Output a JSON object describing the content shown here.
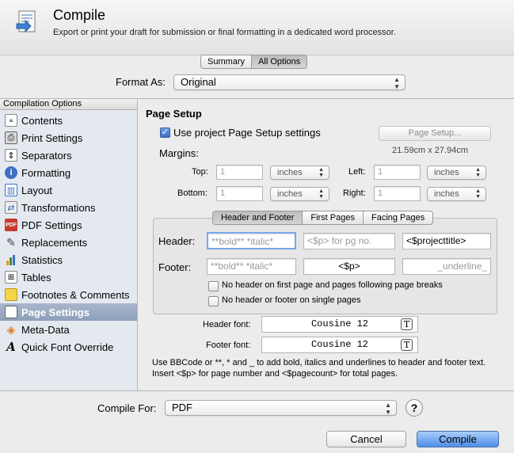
{
  "header": {
    "title": "Compile",
    "subtitle": "Export or print your draft for submission or final formatting in a dedicated word processor."
  },
  "view_tabs": [
    "Summary",
    "All Options"
  ],
  "format_as": {
    "label": "Format As:",
    "value": "Original"
  },
  "sidebar": {
    "header": "Compilation Options",
    "items": [
      {
        "label": "Contents",
        "icon": "contents-icon"
      },
      {
        "label": "Print Settings",
        "icon": "printer-icon"
      },
      {
        "label": "Separators",
        "icon": "separators-icon"
      },
      {
        "label": "Formatting",
        "icon": "formatting-icon"
      },
      {
        "label": "Layout",
        "icon": "layout-icon"
      },
      {
        "label": "Transformations",
        "icon": "transformations-icon"
      },
      {
        "label": "PDF Settings",
        "icon": "pdf-icon"
      },
      {
        "label": "Replacements",
        "icon": "replacements-icon"
      },
      {
        "label": "Statistics",
        "icon": "statistics-icon"
      },
      {
        "label": "Tables",
        "icon": "tables-icon"
      },
      {
        "label": "Footnotes & Comments",
        "icon": "footnotes-icon"
      },
      {
        "label": "Page Settings",
        "icon": "page-settings-icon"
      },
      {
        "label": "Meta-Data",
        "icon": "tag-icon"
      },
      {
        "label": "Quick Font Override",
        "icon": "font-icon"
      }
    ],
    "selected": "Page Settings"
  },
  "page_setup": {
    "heading": "Page Setup",
    "use_project_label": "Use project Page Setup settings",
    "use_project_checked": true,
    "page_setup_button": "Page Setup...",
    "paper_size": "21.59cm x 27.94cm",
    "margins_label": "Margins:",
    "margins": {
      "top": {
        "label": "Top:",
        "value": "1",
        "unit": "inches"
      },
      "left": {
        "label": "Left:",
        "value": "1",
        "unit": "inches"
      },
      "bottom": {
        "label": "Bottom:",
        "value": "1",
        "unit": "inches"
      },
      "right": {
        "label": "Right:",
        "value": "1",
        "unit": "inches"
      }
    }
  },
  "hf_tabs": [
    "Header and Footer",
    "First Pages",
    "Facing Pages"
  ],
  "header_footer": {
    "header_label": "Header:",
    "footer_label": "Footer:",
    "header_fields": [
      "**bold** *italic*",
      "<$p> for pg no.",
      "<$projecttitle>"
    ],
    "footer_fields": [
      "**bold** *italic*",
      "<$p>",
      "_underline_"
    ],
    "no_header_first": "No header on first page and pages following page breaks",
    "no_header_single": "No header or footer on single pages"
  },
  "fonts": {
    "header_font_label": "Header font:",
    "header_font": "Cousine 12",
    "footer_font_label": "Footer font:",
    "footer_font": "Cousine 12"
  },
  "help_text": "Use BBCode or **, * and _ to add bold, italics and underlines to header and footer text. Insert <$p> for page number and <$pagecount> for total pages.",
  "compile_for": {
    "label": "Compile For:",
    "value": "PDF"
  },
  "buttons": {
    "cancel": "Cancel",
    "compile": "Compile",
    "help": "?"
  },
  "colors": {
    "selection": "#8ea0bb",
    "primary_button": "#4f8fe6"
  }
}
